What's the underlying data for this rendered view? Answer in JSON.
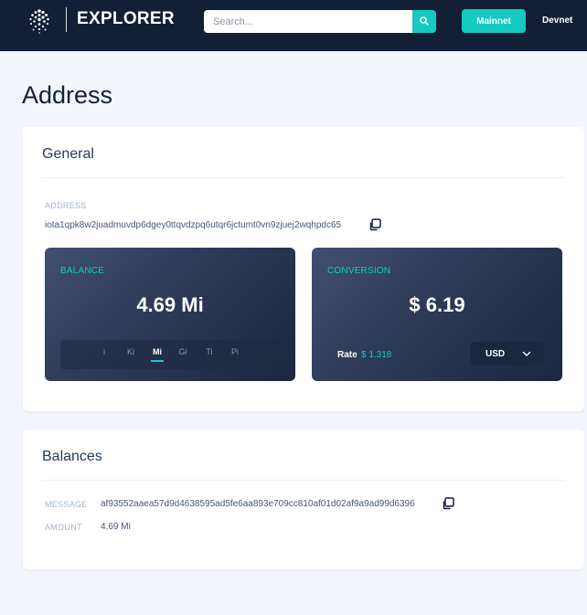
{
  "header": {
    "logo_text": "EXPLORER",
    "search_placeholder": "Search...",
    "network_button": "Mainnet",
    "network_link": "Devnet",
    "icons": {
      "logo": "iota-logo-icon",
      "search": "search-icon"
    }
  },
  "page": {
    "title": "Address"
  },
  "general": {
    "title": "General",
    "address_label": "ADDRESS",
    "address": "iota1qpk8w2juadmuvdp6dgey0ttqvdzpq6utqr6jctumt0vn9zjuej2wqhpdc65",
    "balance": {
      "label": "BALANCE",
      "value": "4.69 Mi",
      "units": [
        "i",
        "Ki",
        "Mi",
        "Gi",
        "Ti",
        "Pi"
      ],
      "selected_unit": "Mi"
    },
    "conversion": {
      "label": "CONVERSION",
      "value": "$ 6.19",
      "rate_label": "Rate",
      "rate_value": "$ 1.318",
      "currency": "USD"
    }
  },
  "balances": {
    "title": "Balances",
    "message_label": "MESSAGE",
    "message": "af93552aaea57d9d4638595ad5fe6aa893e709cc810af01d02af9a9ad99d6396",
    "amount_label": "AMOUNT",
    "amount": "4.69 Mi"
  },
  "colors": {
    "accent": "#14cabf",
    "header_bg": "#131f37",
    "page_bg": "#f2f5fb"
  }
}
